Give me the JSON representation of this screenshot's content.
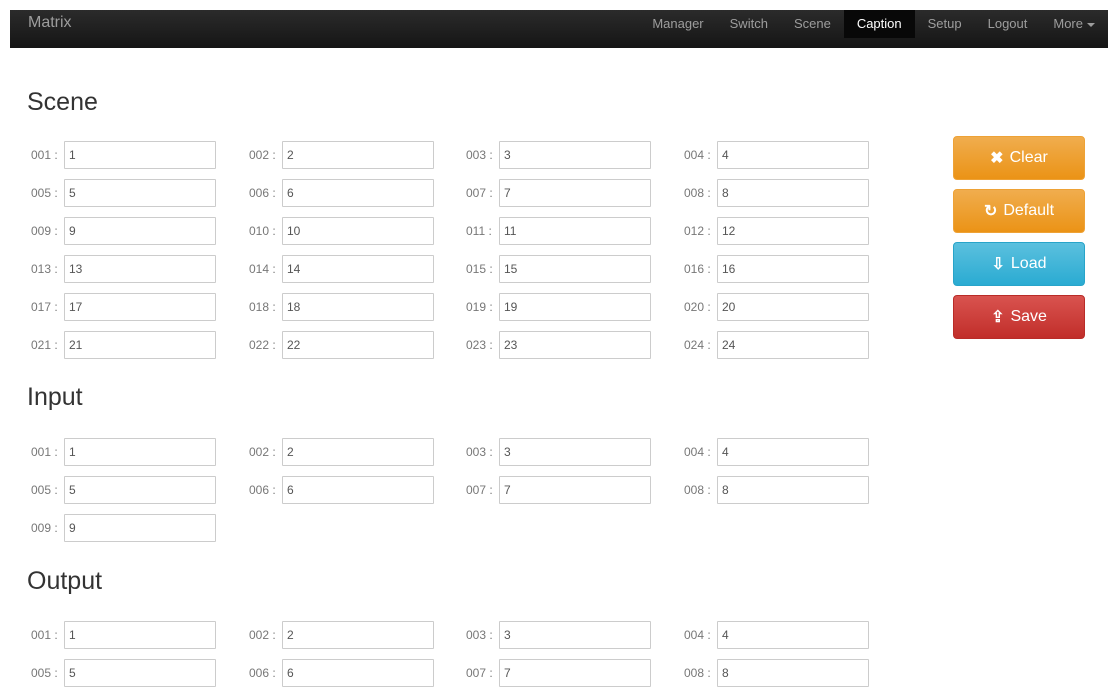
{
  "navbar": {
    "brand": "Matrix",
    "items": [
      {
        "label": "Manager"
      },
      {
        "label": "Switch"
      },
      {
        "label": "Scene"
      },
      {
        "label": "Caption",
        "active": true
      },
      {
        "label": "Setup"
      },
      {
        "label": "Logout"
      },
      {
        "label": "More",
        "dropdown": true
      }
    ]
  },
  "sections": [
    {
      "title": "Scene",
      "fields": [
        {
          "label": "001 :",
          "value": "1"
        },
        {
          "label": "002 :",
          "value": "2"
        },
        {
          "label": "003 :",
          "value": "3"
        },
        {
          "label": "004 :",
          "value": "4"
        },
        {
          "label": "005 :",
          "value": "5"
        },
        {
          "label": "006 :",
          "value": "6"
        },
        {
          "label": "007 :",
          "value": "7"
        },
        {
          "label": "008 :",
          "value": "8"
        },
        {
          "label": "009 :",
          "value": "9"
        },
        {
          "label": "010 :",
          "value": "10"
        },
        {
          "label": "011 :",
          "value": "11"
        },
        {
          "label": "012 :",
          "value": "12"
        },
        {
          "label": "013 :",
          "value": "13"
        },
        {
          "label": "014 :",
          "value": "14"
        },
        {
          "label": "015 :",
          "value": "15"
        },
        {
          "label": "016 :",
          "value": "16"
        },
        {
          "label": "017 :",
          "value": "17"
        },
        {
          "label": "018 :",
          "value": "18"
        },
        {
          "label": "019 :",
          "value": "19"
        },
        {
          "label": "020 :",
          "value": "20"
        },
        {
          "label": "021 :",
          "value": "21"
        },
        {
          "label": "022 :",
          "value": "22"
        },
        {
          "label": "023 :",
          "value": "23"
        },
        {
          "label": "024 :",
          "value": "24"
        }
      ]
    },
    {
      "title": "Input",
      "fields": [
        {
          "label": "001 :",
          "value": "1"
        },
        {
          "label": "002 :",
          "value": "2"
        },
        {
          "label": "003 :",
          "value": "3"
        },
        {
          "label": "004 :",
          "value": "4"
        },
        {
          "label": "005 :",
          "value": "5"
        },
        {
          "label": "006 :",
          "value": "6"
        },
        {
          "label": "007 :",
          "value": "7"
        },
        {
          "label": "008 :",
          "value": "8"
        },
        {
          "label": "009 :",
          "value": "9"
        }
      ]
    },
    {
      "title": "Output",
      "fields": [
        {
          "label": "001 :",
          "value": "1"
        },
        {
          "label": "002 :",
          "value": "2"
        },
        {
          "label": "003 :",
          "value": "3"
        },
        {
          "label": "004 :",
          "value": "4"
        },
        {
          "label": "005 :",
          "value": "5"
        },
        {
          "label": "006 :",
          "value": "6"
        },
        {
          "label": "007 :",
          "value": "7"
        },
        {
          "label": "008 :",
          "value": "8"
        }
      ]
    }
  ],
  "actions": [
    {
      "label": "Clear",
      "icon": "times-icon",
      "glyph": "✖",
      "color": "#f0ad4e"
    },
    {
      "label": "Default",
      "icon": "refresh-icon",
      "glyph": "↻",
      "color": "#f0ad4e"
    },
    {
      "label": "Load",
      "icon": "load-icon",
      "glyph": "⇩",
      "color": "#5bc0de"
    },
    {
      "label": "Save",
      "icon": "save-icon",
      "glyph": "⇪",
      "color": "#d9534f"
    }
  ]
}
